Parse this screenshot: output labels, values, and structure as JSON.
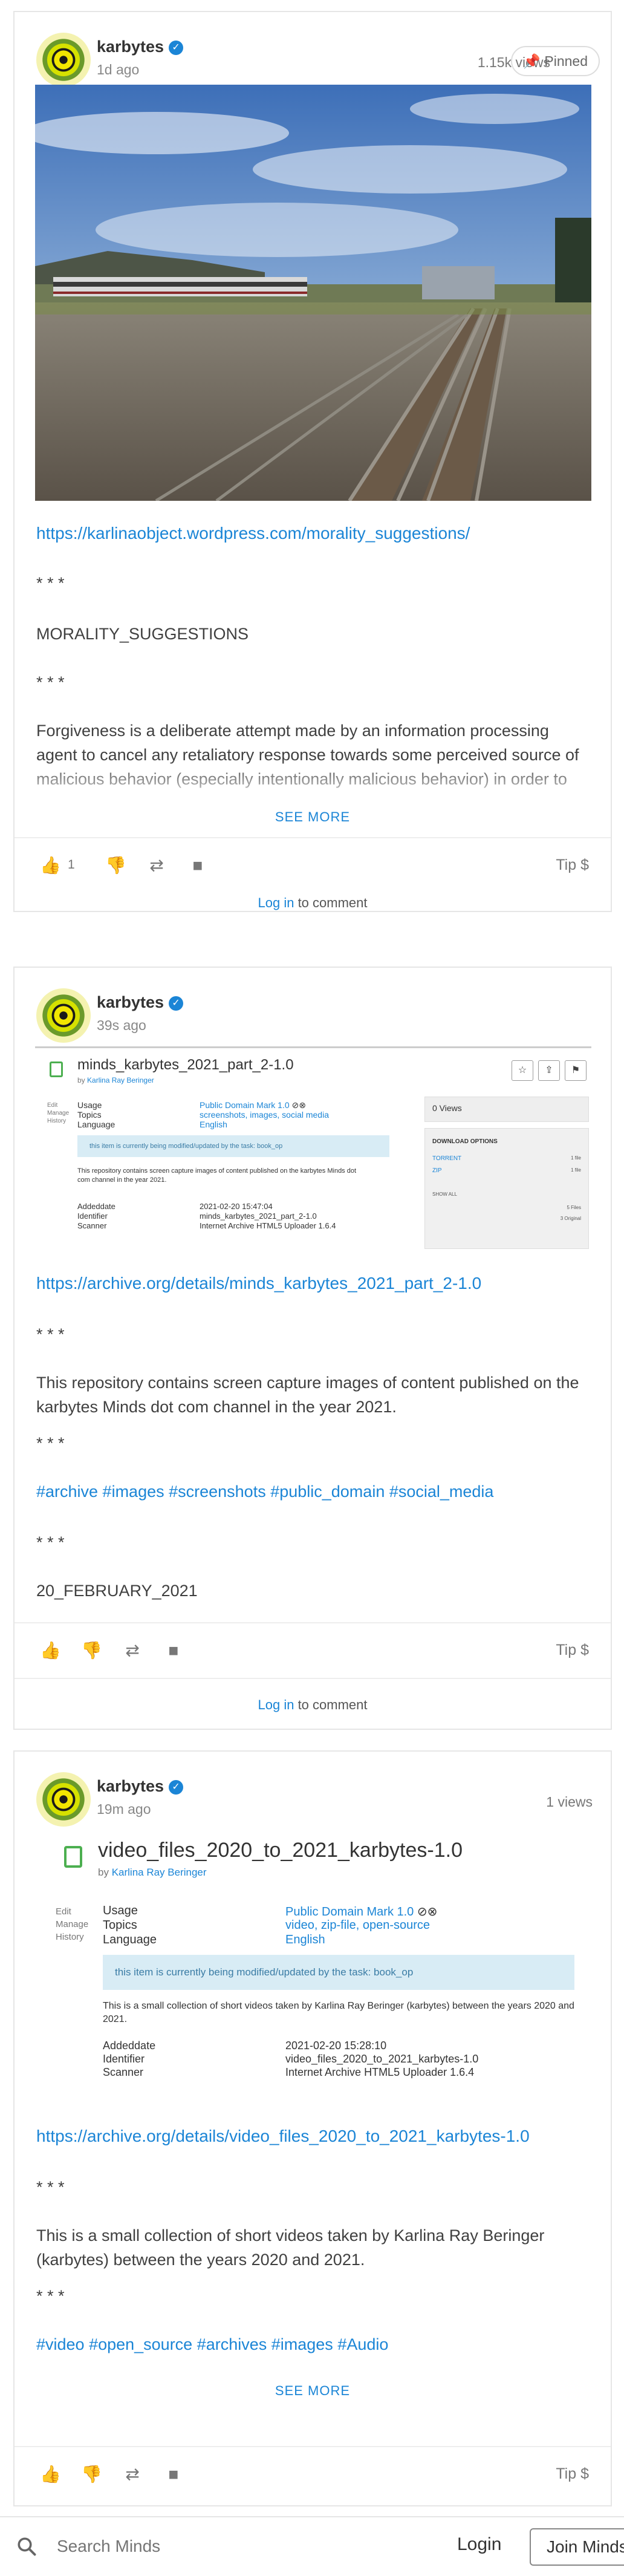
{
  "posts": [
    {
      "author": "karbytes",
      "time": "1d ago",
      "views": "1.15k views",
      "pinned_label": "Pinned",
      "link": "https://karlinaobject.wordpress.com/morality_suggestions/",
      "sep1": "* * *",
      "heading": "MORALITY_SUGGESTIONS",
      "sep2": "* * *",
      "body": "Forgiveness is a deliberate attempt made by an information processing agent to cancel any retaliatory response towards some perceived source of malicious behavior (especially intentionally malicious behavior) in order to",
      "see_more": "SEE MORE",
      "like_count": "1",
      "tip": "Tip $",
      "login_link": "Log in",
      "comment_suffix": " to comment"
    },
    {
      "author": "karbytes",
      "time": "39s ago",
      "preview": {
        "title": "minds_karbytes_2021_part_2-1.0",
        "by_prefix": "by ",
        "by": "Karlina Ray Beringer",
        "side": [
          "Edit",
          "Manage",
          "History"
        ],
        "rows": [
          {
            "label": "Usage",
            "value": "Public Domain Mark 1.0"
          },
          {
            "label": "Topics",
            "value": "screenshots, images, social media"
          },
          {
            "label": "Language",
            "value": "English"
          }
        ],
        "banner": "this item is currently being modified/updated by the task: book_op",
        "desc": "This repository contains screen capture images of content published on the karbytes Minds dot com channel in the year 2021.",
        "meta": [
          {
            "label": "Addeddate",
            "value": "2021-02-20 15:47:04"
          },
          {
            "label": "Identifier",
            "value": "minds_karbytes_2021_part_2-1.0"
          },
          {
            "label": "Scanner",
            "value": "Internet Archive HTML5 Uploader 1.6.4"
          }
        ],
        "views_box": "0 Views",
        "download_title": "DOWNLOAD OPTIONS",
        "downloads": [
          {
            "name": "TORRENT",
            "count": "1 file"
          },
          {
            "name": "ZIP",
            "count": "1 file"
          }
        ],
        "show_all": "SHOW ALL",
        "files": "5 Files",
        "original": "3 Original"
      },
      "link": "https://archive.org/details/minds_karbytes_2021_part_2-1.0",
      "sep1": "* * *",
      "body": "This repository contains screen capture images of content published on the karbytes Minds dot com channel in the year 2021.",
      "sep2": "* * *",
      "hashtags": "#archive #images #screenshots #public_domain #social_media",
      "sep3": "* * *",
      "date": "20_FEBRUARY_2021",
      "tip": "Tip $",
      "login_link": "Log in",
      "comment_suffix": " to comment"
    },
    {
      "author": "karbytes",
      "time": "19m ago",
      "views": "1 views",
      "preview": {
        "title": "video_files_2020_to_2021_karbytes-1.0",
        "by_prefix": "by ",
        "by": "Karlina Ray Beringer",
        "side": [
          "Edit",
          "Manage",
          "History"
        ],
        "rows": [
          {
            "label": "Usage",
            "value": "Public Domain Mark 1.0"
          },
          {
            "label": "Topics",
            "value": "video, zip-file, open-source"
          },
          {
            "label": "Language",
            "value": "English"
          }
        ],
        "banner": "this item is currently being modified/updated by the task: book_op",
        "desc": "This is a small collection of short videos taken by Karlina Ray Beringer (karbytes) between the years 2020 and 2021.",
        "meta": [
          {
            "label": "Addeddate",
            "value": "2021-02-20 15:28:10"
          },
          {
            "label": "Identifier",
            "value": "video_files_2020_to_2021_karbytes-1.0"
          },
          {
            "label": "Scanner",
            "value": "Internet Archive HTML5 Uploader 1.6.4"
          }
        ]
      },
      "link": "https://archive.org/details/video_files_2020_to_2021_karbytes-1.0",
      "sep1": "* * *",
      "body": "This is a small collection of short videos taken by Karlina Ray Beringer (karbytes) between the years 2020 and 2021.",
      "sep2": "* * *",
      "hashtags": "#video #open_source #archives #images #Audio",
      "see_more": "SEE MORE",
      "tip": "Tip $"
    }
  ],
  "bottom_bar": {
    "search_placeholder": "Search Minds",
    "login": "Login",
    "join": "Join Minds"
  },
  "colors": {
    "accent": "#1b85d6",
    "verified": "#1b85d6"
  }
}
